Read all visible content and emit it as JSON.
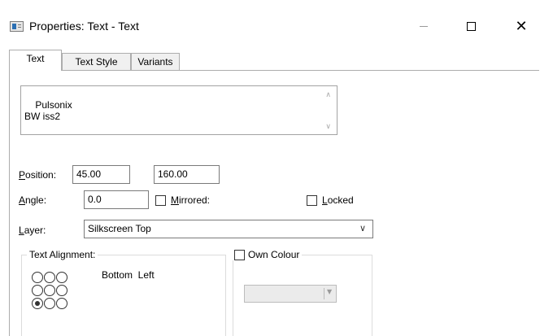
{
  "window": {
    "title": "Properties: Text - Text",
    "minimize_icon": "minimize-icon",
    "maximize_icon": "maximize-icon",
    "close_glyph": "✕"
  },
  "tabs": [
    {
      "label": "Text",
      "active": true
    },
    {
      "label": "Text Style",
      "active": false
    },
    {
      "label": "Variants",
      "active": false
    }
  ],
  "text_content": "Pulsonix\nBW iss2",
  "position": {
    "label_u": "P",
    "label_rest": "osition:",
    "x": "45.00",
    "y": "160.00"
  },
  "angle": {
    "label_u": "A",
    "label_rest": "ngle:",
    "value": "0.0"
  },
  "mirrored": {
    "label_u": "M",
    "label_rest": "irrored:",
    "checked": false
  },
  "locked": {
    "label_u": "L",
    "label_rest": "ocked",
    "checked": false
  },
  "layer": {
    "label_u": "L",
    "label_rest": "ayer:",
    "value": "Silkscreen Top"
  },
  "alignment": {
    "legend": "Text Alignment:",
    "selected_text": "Bottom  Left",
    "selected_index": 6
  },
  "own_colour": {
    "label": "Own Colour",
    "checked": false
  },
  "colors": {
    "accent": "#2b6fb3",
    "border": "#adadad"
  }
}
